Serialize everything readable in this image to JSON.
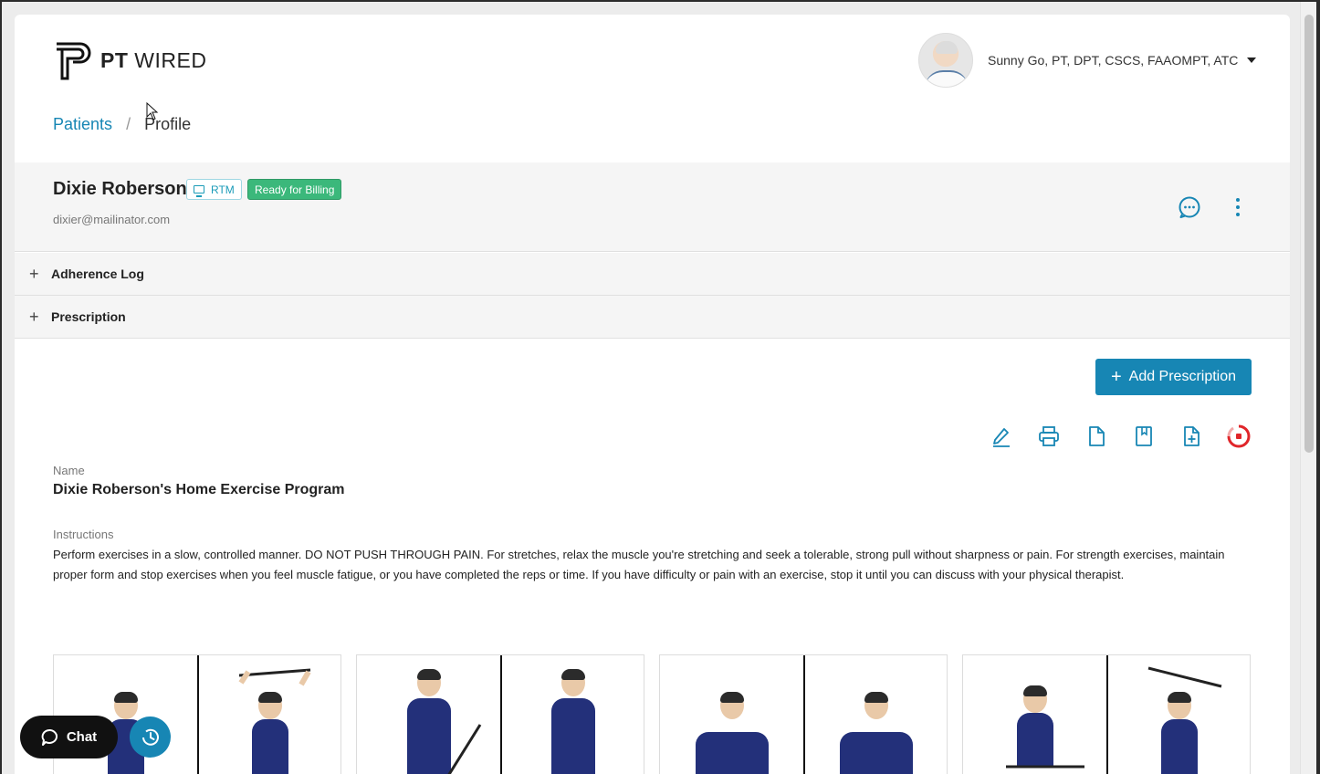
{
  "app": {
    "brand_bold": "PT",
    "brand_rest": "WIRED"
  },
  "user": {
    "name": "Sunny Go, PT, DPT, CSCS, FAAOMPT, ATC"
  },
  "breadcrumb": {
    "parent": "Patients",
    "separator": "/",
    "current": "Profile"
  },
  "patient": {
    "name": "Dixie Roberson",
    "email": "dixier@mailinator.com",
    "badge_rtm": "RTM",
    "badge_status": "Ready for Billing"
  },
  "sections": [
    {
      "label": "Adherence Log",
      "toggle": "+"
    },
    {
      "label": "Prescription",
      "toggle": "+"
    }
  ],
  "prescription": {
    "add_button": "Add Prescription",
    "name_label": "Name",
    "name_value": "Dixie Roberson's Home Exercise Program",
    "instructions_label": "Instructions",
    "instructions_value": "Perform exercises in a slow, controlled manner. DO NOT PUSH THROUGH PAIN. For stretches, relax the muscle you're stretching and seek a tolerable, strong pull without sharpness or pain. For strength exercises, maintain proper form and stop exercises when you feel muscle fatigue, or you have completed the reps or time. If you have difficulty or pain with an exercise, stop it until you can discuss with your physical therapist."
  },
  "toolbar_icons": [
    "pencil-icon",
    "printer-icon",
    "document-icon",
    "bookmark-icon",
    "file-add-icon",
    "record-icon"
  ],
  "exercises": [
    {
      "icon": "exercise-overhead-stick-raise"
    },
    {
      "icon": "exercise-shoulder-stick-rotation"
    },
    {
      "icon": "exercise-neck-rotation"
    },
    {
      "icon": "exercise-seated-overhead-stick-raise"
    }
  ],
  "floating": {
    "chat_label": "Chat"
  },
  "colors": {
    "accent": "#1786b4",
    "status_green": "#3bb87b",
    "record_red": "#e0262a"
  }
}
